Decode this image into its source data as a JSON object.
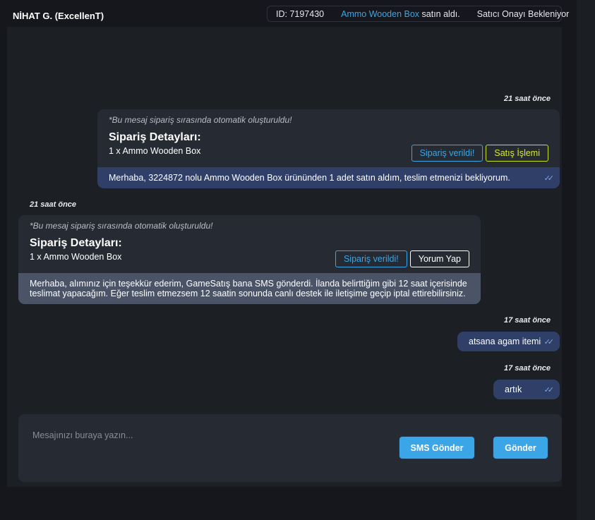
{
  "header": {
    "user_name": "NİHAT G. (ExcellenT)",
    "order_id": "ID: 7197430",
    "product_link": "Ammo Wooden Box",
    "purchase_text": "satın aldı.",
    "status": "Satıcı Onayı Bekleniyor"
  },
  "messages": {
    "card1": {
      "timestamp": "21 saat önce",
      "auto_note": "*Bu mesaj sipariş sırasında otomatik oluşturuldu!",
      "title": "Sipariş Detayları:",
      "item": "1 x Ammo Wooden Box",
      "button1": "Sipariş verildi!",
      "button2": "Satış İşlemi",
      "text": "Merhaba, 3224872 nolu Ammo Wooden Box ürününden 1 adet satın aldım, teslim etmenizi bekliyorum.",
      "ticks": "✓✓"
    },
    "card2": {
      "timestamp": "21 saat önce",
      "auto_note": "*Bu mesaj sipariş sırasında otomatik oluşturuldu!",
      "title": "Sipariş Detayları:",
      "item": "1 x Ammo Wooden Box",
      "button1": "Sipariş verildi!",
      "button2": "Yorum Yap",
      "text": "Merhaba, alımınız için teşekkür ederim, GameSatış bana SMS gönderdi. İlanda belirttiğim gibi 12 saat içerisinde teslimat yapacağım. Eğer teslim etmezsem 12 saatin sonunda canlı destek ile iletişime geçip iptal ettirebilirsiniz."
    },
    "msg3": {
      "timestamp": "17 saat önce",
      "text": "atsana agam itemi",
      "ticks": "✓✓"
    },
    "msg4": {
      "timestamp": "17 saat önce",
      "text": "artık",
      "ticks": "✓✓"
    }
  },
  "composer": {
    "placeholder": "Mesajınızı buraya yazın...",
    "sms_button": "SMS Gönder",
    "send_button": "Gönder"
  },
  "colors": {
    "accent": "#3aa6e8",
    "outgoing_bubble": "#2f3f67",
    "incoming_bubble": "#4a5466",
    "highlight_button": "#c7e020"
  }
}
